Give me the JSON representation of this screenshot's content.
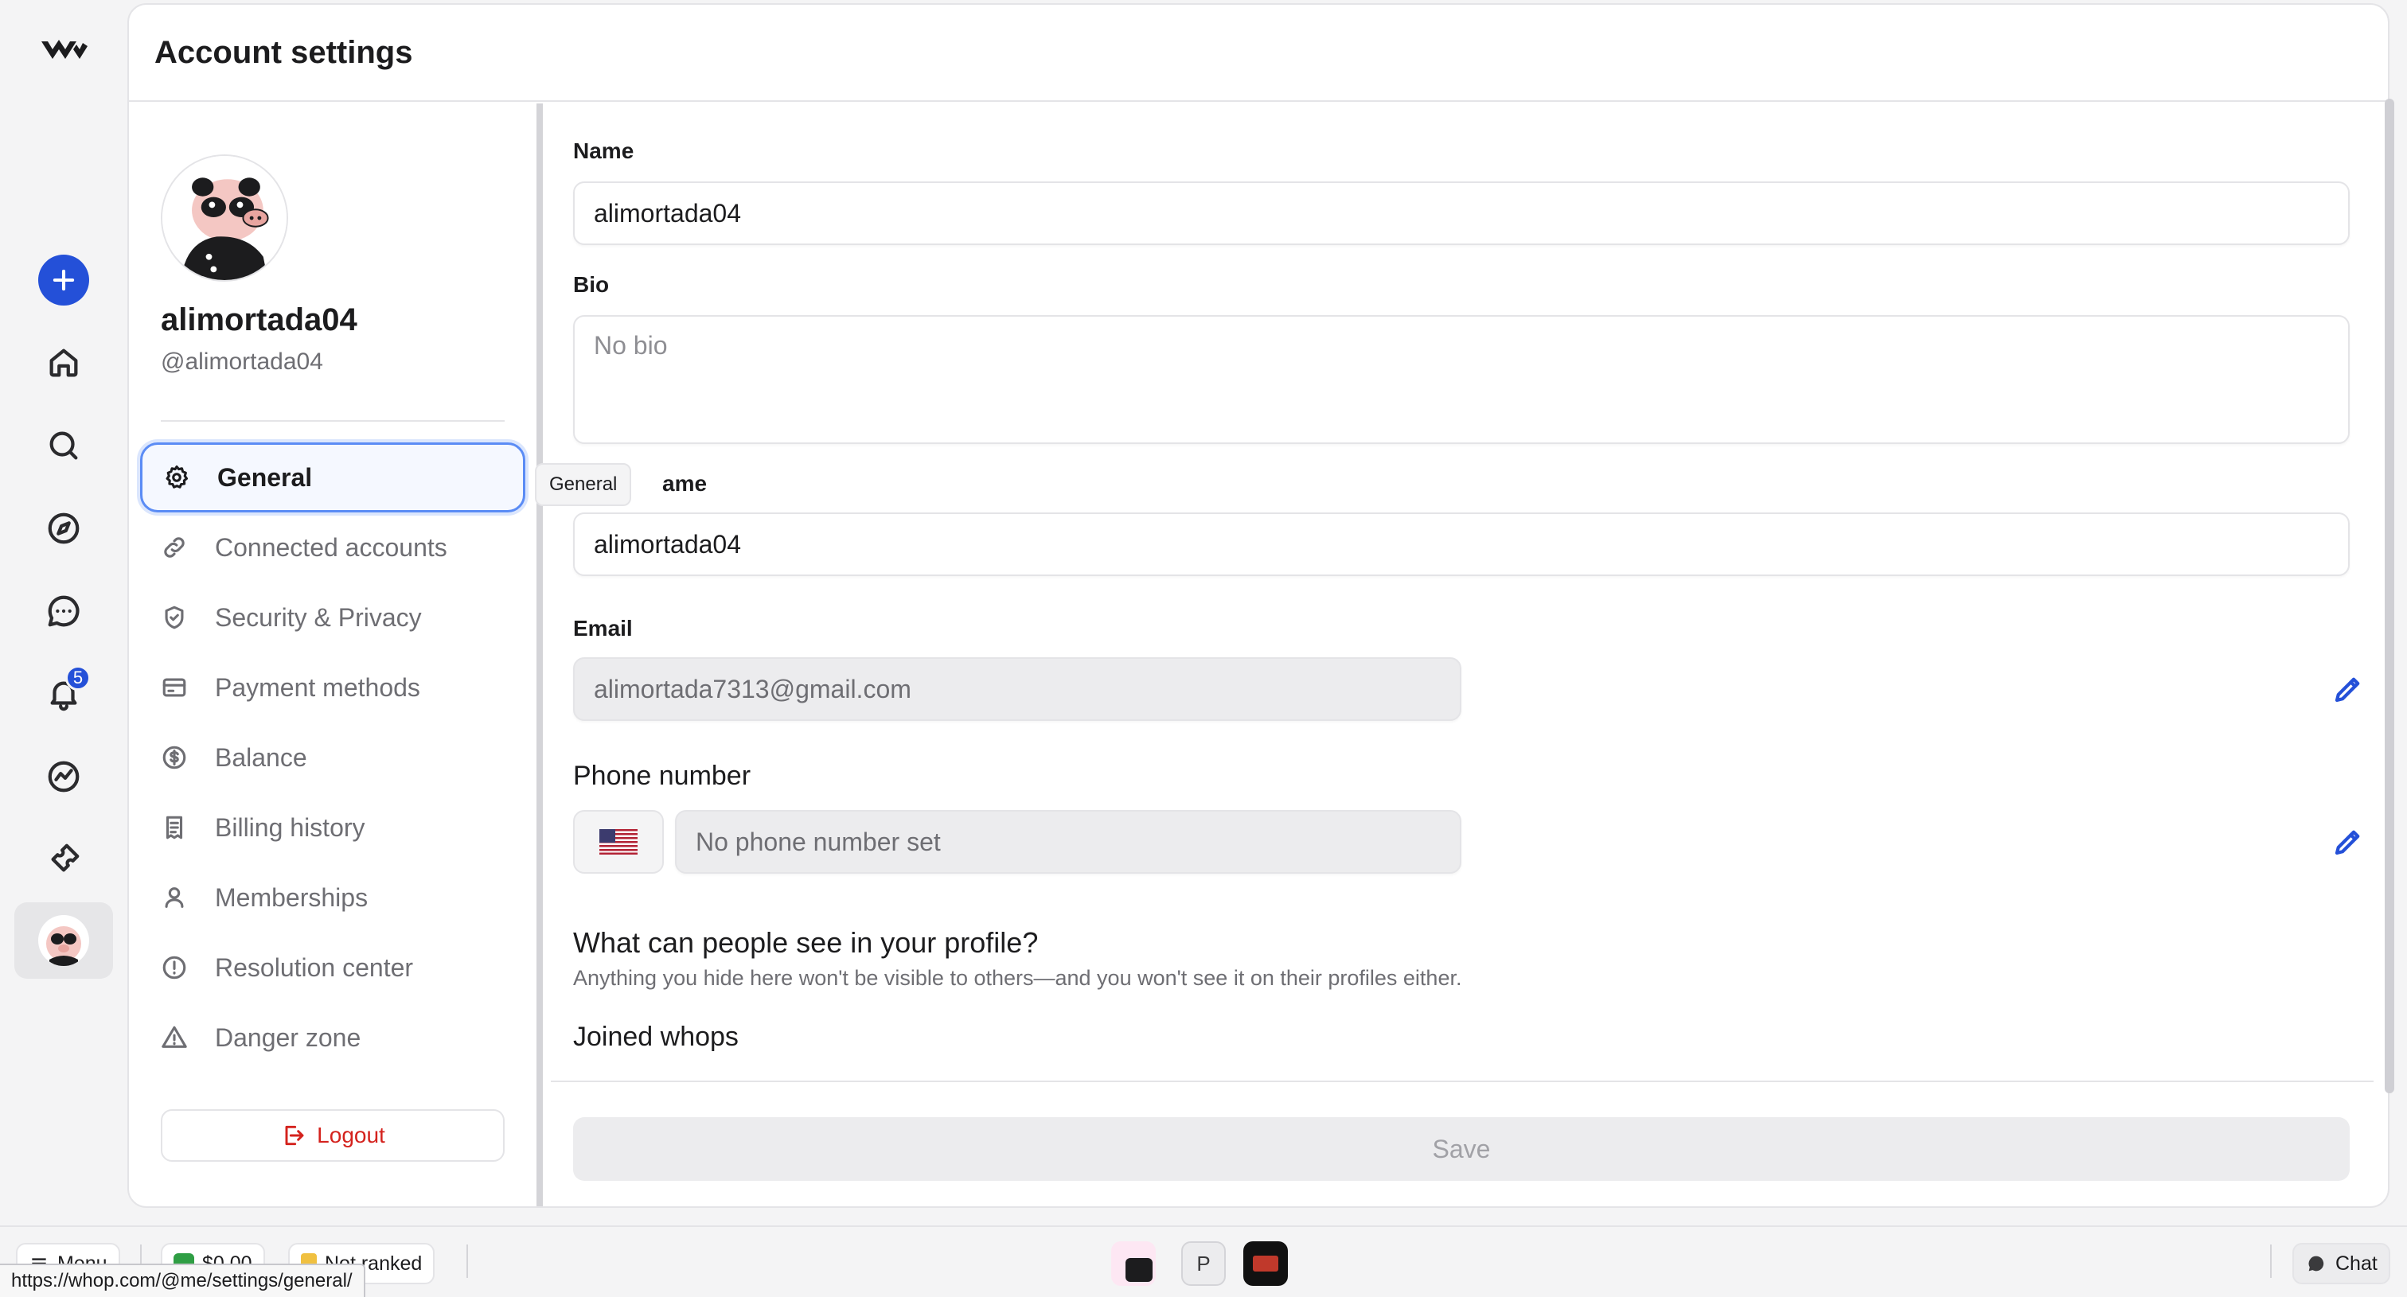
{
  "header": {
    "title": "Account settings"
  },
  "rail": {
    "notification_count": "5"
  },
  "profile": {
    "name": "alimortada04",
    "handle": "@alimortada04"
  },
  "nav": {
    "items": [
      {
        "label": "General",
        "icon": "gear-icon",
        "active": true
      },
      {
        "label": "Connected accounts",
        "icon": "link-icon"
      },
      {
        "label": "Security & Privacy",
        "icon": "shield-icon"
      },
      {
        "label": "Payment methods",
        "icon": "credit-card-icon"
      },
      {
        "label": "Balance",
        "icon": "dollar-circle-icon"
      },
      {
        "label": "Billing history",
        "icon": "receipt-icon"
      },
      {
        "label": "Memberships",
        "icon": "user-icon"
      },
      {
        "label": "Resolution center",
        "icon": "alert-circle-icon"
      },
      {
        "label": "Danger zone",
        "icon": "warning-triangle-icon"
      }
    ],
    "tooltip": "General",
    "logout_label": "Logout"
  },
  "form": {
    "name_label": "Name",
    "name_value": "alimortada04",
    "bio_label": "Bio",
    "bio_placeholder": "No bio",
    "username_label": "ame",
    "username_value": "alimortada04",
    "email_label": "Email",
    "email_value": "alimortada7313@gmail.com",
    "phone_label": "Phone number",
    "phone_placeholder": "No phone number set",
    "visibility_title": "What can people see in your profile?",
    "visibility_subtitle": "Anything you hide here won't be visible to others—and you won't see it on their profiles either.",
    "joined_whops_label": "Joined whops",
    "joined_whops_enabled": true,
    "save_label": "Save"
  },
  "bottom_bar": {
    "menu_label": "Menu",
    "balance": "$0.00",
    "rank": "Not ranked",
    "app_p_label": "P",
    "chat_label": "Chat"
  },
  "status_url": "https://whop.com/@me/settings/general/",
  "colors": {
    "accent": "#2450d8",
    "danger": "#d4221d",
    "active_border": "#5b8cf5"
  }
}
